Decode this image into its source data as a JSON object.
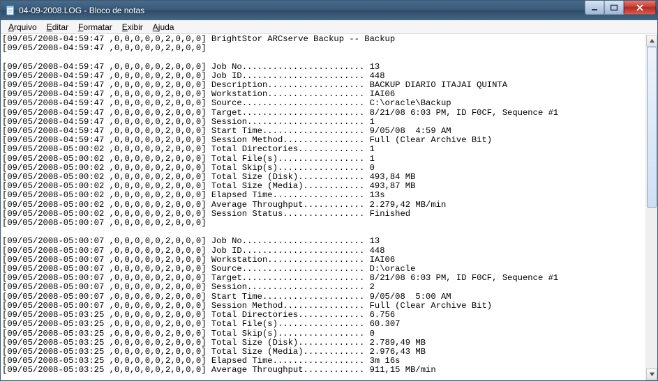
{
  "window": {
    "title": "04-09-2008.LOG - Bloco de notas"
  },
  "menu": {
    "items": [
      {
        "hot": "A",
        "rest": "rquivo"
      },
      {
        "hot": "E",
        "rest": "ditar"
      },
      {
        "hot": "F",
        "rest": "ormatar"
      },
      {
        "hot": "E",
        "rest": "xibir"
      },
      {
        "hot": "A",
        "rest": "juda"
      }
    ]
  },
  "log": {
    "header": "[09/05/2008-04:59:47 ,0,0,0,0,0,2,0,0,0] BrightStor ARCserve Backup -- Backup\n[09/05/2008-04:59:47 ,0,0,0,0,0,2,0,0,0]\n",
    "session1": [
      {
        "ts": "09/05/2008-04:59:47",
        "label": "Job No",
        "value": "13"
      },
      {
        "ts": "09/05/2008-04:59:47",
        "label": "Job ID",
        "value": "448"
      },
      {
        "ts": "09/05/2008-04:59:47",
        "label": "Description",
        "value": "BACKUP DIARIO ITAJAI QUINTA"
      },
      {
        "ts": "09/05/2008-04:59:47",
        "label": "Workstation",
        "value": "IAI06"
      },
      {
        "ts": "09/05/2008-04:59:47",
        "label": "Source",
        "value": "C:\\oracle\\Backup"
      },
      {
        "ts": "09/05/2008-04:59:47",
        "label": "Target",
        "value": "8/21/08 6:03 PM, ID F0CF, Sequence #1"
      },
      {
        "ts": "09/05/2008-04:59:47",
        "label": "Session",
        "value": "1"
      },
      {
        "ts": "09/05/2008-04:59:47",
        "label": "Start Time",
        "value": "9/05/08  4:59 AM"
      },
      {
        "ts": "09/05/2008-04:59:47",
        "label": "Session Method",
        "value": "Full (Clear Archive Bit)"
      },
      {
        "ts": "09/05/2008-05:00:02",
        "label": "Total Directories",
        "value": "1"
      },
      {
        "ts": "09/05/2008-05:00:02",
        "label": "Total File(s)",
        "value": "1"
      },
      {
        "ts": "09/05/2008-05:00:02",
        "label": "Total Skip(s)",
        "value": "0"
      },
      {
        "ts": "09/05/2008-05:00:02",
        "label": "Total Size (Disk)",
        "value": "493,84 MB"
      },
      {
        "ts": "09/05/2008-05:00:02",
        "label": "Total Size (Media)",
        "value": "493,87 MB"
      },
      {
        "ts": "09/05/2008-05:00:02",
        "label": "Elapsed Time",
        "value": "13s"
      },
      {
        "ts": "09/05/2008-05:00:02",
        "label": "Average Throughput",
        "value": "2.279,42 MB/min"
      },
      {
        "ts": "09/05/2008-05:00:02",
        "label": "Session Status",
        "value": "Finished"
      }
    ],
    "separator": "[09/05/2008-05:00:07 ,0,0,0,0,0,2,0,0,0]\n",
    "session2": [
      {
        "ts": "09/05/2008-05:00:07",
        "label": "Job No",
        "value": "13"
      },
      {
        "ts": "09/05/2008-05:00:07",
        "label": "Job ID",
        "value": "448"
      },
      {
        "ts": "09/05/2008-05:00:07",
        "label": "Workstation",
        "value": "IAI06"
      },
      {
        "ts": "09/05/2008-05:00:07",
        "label": "Source",
        "value": "D:\\oracle"
      },
      {
        "ts": "09/05/2008-05:00:07",
        "label": "Target",
        "value": "8/21/08 6:03 PM, ID F0CF, Sequence #1"
      },
      {
        "ts": "09/05/2008-05:00:07",
        "label": "Session",
        "value": "2"
      },
      {
        "ts": "09/05/2008-05:00:07",
        "label": "Start Time",
        "value": "9/05/08  5:00 AM"
      },
      {
        "ts": "09/05/2008-05:00:07",
        "label": "Session Method",
        "value": "Full (Clear Archive Bit)"
      },
      {
        "ts": "09/05/2008-05:03:25",
        "label": "Total Directories",
        "value": "6.756"
      },
      {
        "ts": "09/05/2008-05:03:25",
        "label": "Total File(s)",
        "value": "60.307"
      },
      {
        "ts": "09/05/2008-05:03:25",
        "label": "Total Skip(s)",
        "value": "0"
      },
      {
        "ts": "09/05/2008-05:03:25",
        "label": "Total Size (Disk)",
        "value": "2.789,49 MB"
      },
      {
        "ts": "09/05/2008-05:03:25",
        "label": "Total Size (Media)",
        "value": "2.976,43 MB"
      },
      {
        "ts": "09/05/2008-05:03:25",
        "label": "Elapsed Time",
        "value": "3m 16s"
      },
      {
        "ts": "09/05/2008-05:03:25",
        "label": "Average Throughput",
        "value": "911,15 MB/min"
      }
    ],
    "prefix_flags": ",0,0,0,0,0,2,0,0,0",
    "label_width": 30,
    "scroll": {
      "thumb_top_pct": 0,
      "thumb_height_pct": 50
    }
  }
}
